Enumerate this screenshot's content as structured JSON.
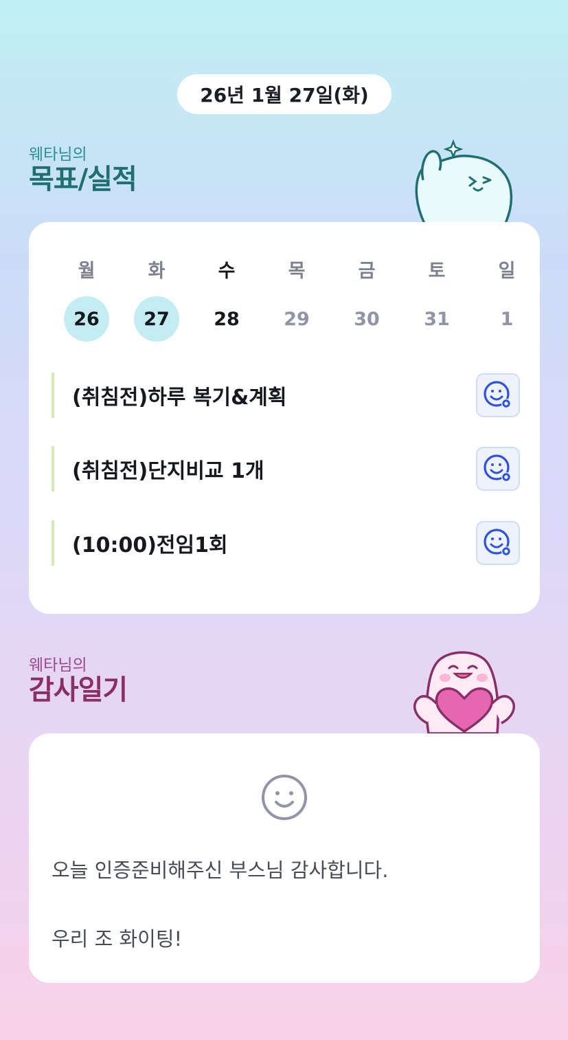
{
  "header": {
    "date": "26년 1월 27일(화)"
  },
  "goals": {
    "title_small": "웨타님의",
    "title_big": "목표/실적",
    "week": [
      {
        "weekday": "월",
        "date": "26",
        "state": "past"
      },
      {
        "weekday": "화",
        "date": "27",
        "state": "past"
      },
      {
        "weekday": "수",
        "date": "28",
        "state": "today"
      },
      {
        "weekday": "목",
        "date": "29",
        "state": "future"
      },
      {
        "weekday": "금",
        "date": "30",
        "state": "future"
      },
      {
        "weekday": "토",
        "date": "31",
        "state": "future"
      },
      {
        "weekday": "일",
        "date": "1",
        "state": "future"
      }
    ],
    "tasks": [
      {
        "label": "(취침전)하루 복기&계획",
        "icon": "smile-badge-icon"
      },
      {
        "label": "(취침전)단지비교 1개",
        "icon": "smile-badge-icon"
      },
      {
        "label": "(10:00)전임1회",
        "icon": "smile-badge-icon"
      }
    ]
  },
  "thanks": {
    "title_small": "웨타님의",
    "title_big": "감사일기",
    "icon": "smile-icon",
    "lines": [
      "오늘 인증준비해주신 부스님 감사합니다.",
      "우리 조 화이팅!"
    ]
  },
  "colors": {
    "goal_title": "#1f6f72",
    "thanks_title": "#8a2e68",
    "past_day_circle": "#c3edf2",
    "task_bar": "#d4ecb0",
    "task_icon": "#2b52e0"
  }
}
